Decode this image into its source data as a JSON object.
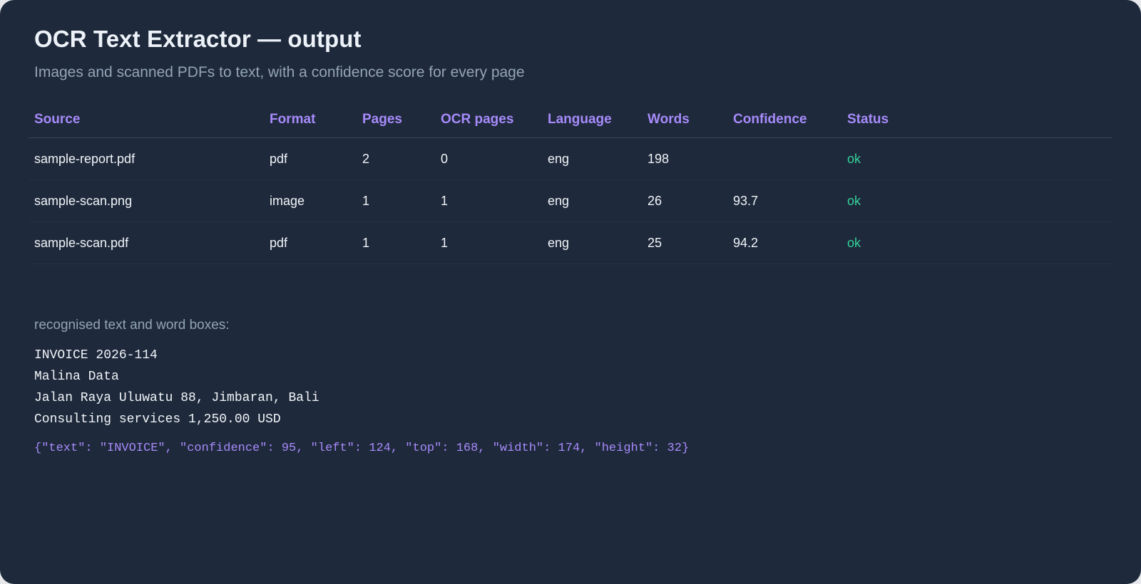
{
  "header": {
    "title": "OCR Text Extractor — output",
    "subtitle": "Images and scanned PDFs to text, with a confidence score for every page"
  },
  "table": {
    "columns": {
      "source": "Source",
      "format": "Format",
      "pages": "Pages",
      "ocr_pages": "OCR pages",
      "language": "Language",
      "words": "Words",
      "confidence": "Confidence",
      "status": "Status"
    },
    "rows": [
      {
        "source": "sample-report.pdf",
        "format": "pdf",
        "pages": "2",
        "ocr_pages": "0",
        "language": "eng",
        "words": "198",
        "confidence": "",
        "status": "ok"
      },
      {
        "source": "sample-scan.png",
        "format": "image",
        "pages": "1",
        "ocr_pages": "1",
        "language": "eng",
        "words": "26",
        "confidence": "93.7",
        "status": "ok"
      },
      {
        "source": "sample-scan.pdf",
        "format": "pdf",
        "pages": "1",
        "ocr_pages": "1",
        "language": "eng",
        "words": "25",
        "confidence": "94.2",
        "status": "ok"
      }
    ]
  },
  "extraction": {
    "label": "recognised text and word boxes:",
    "lines": [
      "INVOICE 2026-114",
      "Malina Data",
      "Jalan Raya Uluwatu 88, Jimbaran, Bali",
      "Consulting services 1,250.00 USD"
    ],
    "word_box": "{\"text\": \"INVOICE\", \"confidence\": 95, \"left\": 124, \"top\": 168, \"width\": 174, \"height\": 32}"
  },
  "colors": {
    "background": "#1e293b",
    "header_accent": "#a78bfa",
    "status_ok": "#34d399",
    "muted_text": "#94a3b8"
  }
}
